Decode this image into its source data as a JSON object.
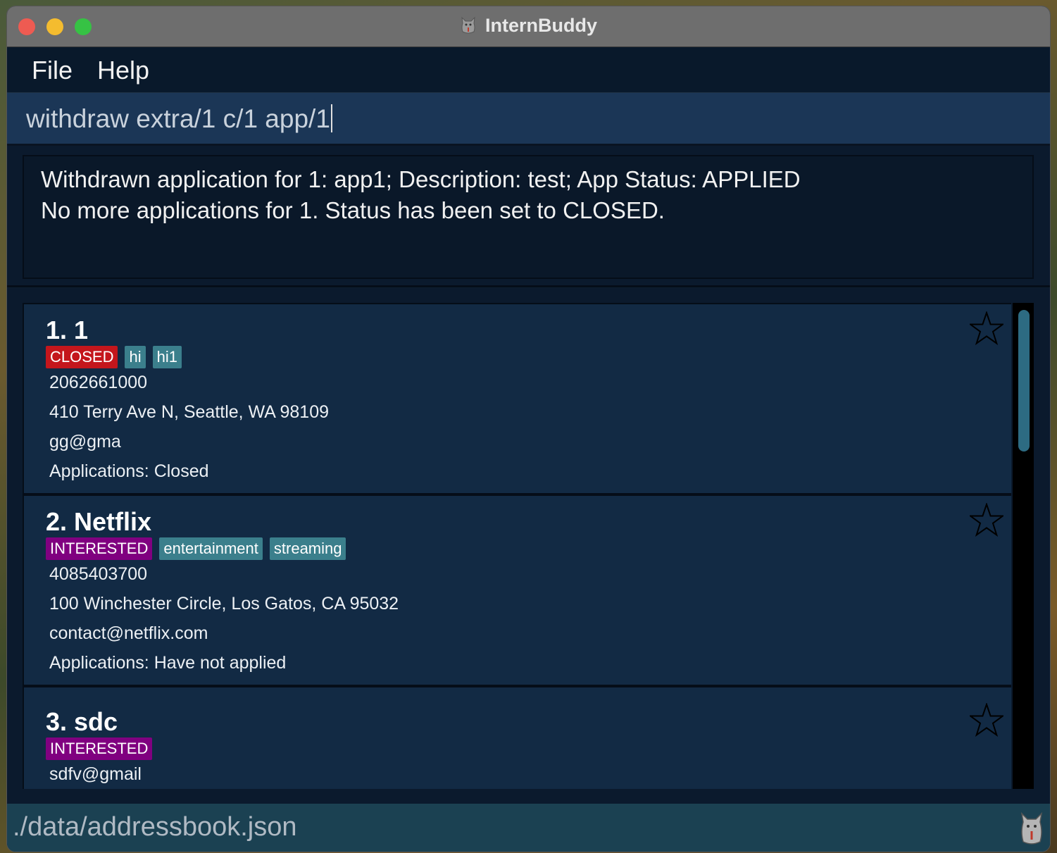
{
  "window": {
    "title": "InternBuddy"
  },
  "menu": {
    "file_label": "File",
    "help_label": "Help"
  },
  "command": {
    "value": "withdraw extra/1 c/1 app/1"
  },
  "result": {
    "line1": "Withdrawn application for 1: app1; Description: test; App Status: APPLIED",
    "line2": "No more applications for 1. Status has been set to CLOSED."
  },
  "companies": [
    {
      "name": "1. 1",
      "status": "CLOSED",
      "tags": [
        "hi",
        "hi1"
      ],
      "phone": "2062661000",
      "address": "410 Terry Ave N, Seattle, WA 98109",
      "email": "gg@gma",
      "applications": "Applications: Closed"
    },
    {
      "name": "2. Netflix",
      "status": "INTERESTED",
      "tags": [
        "entertainment",
        "streaming"
      ],
      "phone": "4085403700",
      "address": "100 Winchester Circle, Los Gatos, CA 95032",
      "email": "contact@netflix.com",
      "applications": "Applications: Have not applied"
    },
    {
      "name": "3. sdc",
      "status": "INTERESTED",
      "tags": [],
      "email": "sdfv@gmail"
    }
  ],
  "statusbar": {
    "path": "./data/addressbook.json"
  },
  "colors": {
    "status_closed": "#c4161c",
    "status_interested": "#800080",
    "tag": "#3b7f8c",
    "card_bg": "#122a44"
  },
  "icons": {
    "favorite": "star-outline-icon",
    "app": "cat-mascot-icon"
  }
}
